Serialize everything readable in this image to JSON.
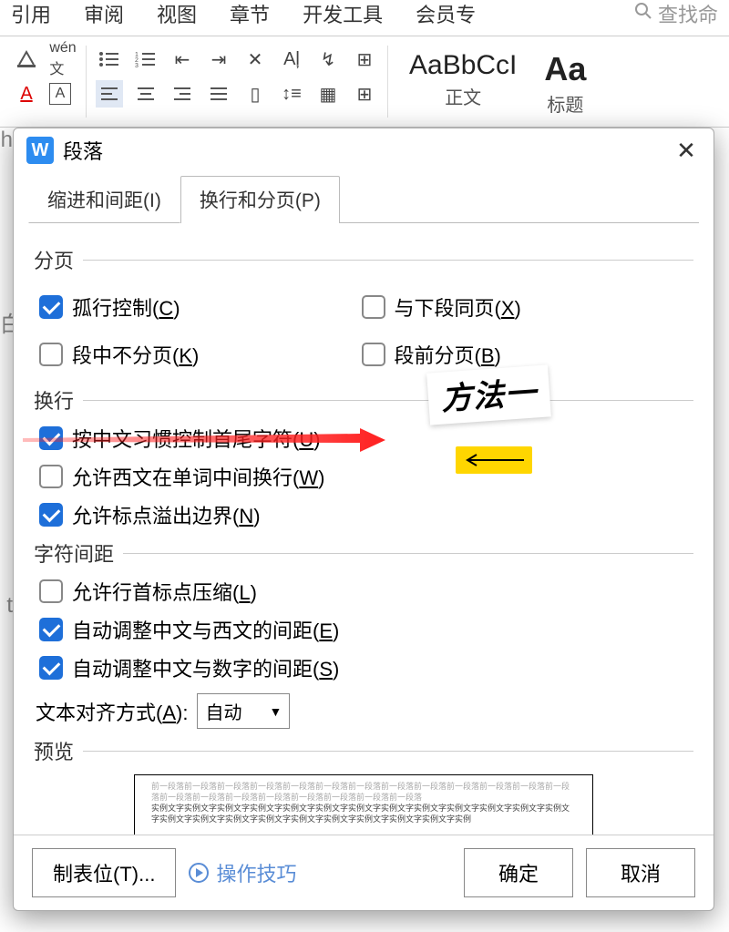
{
  "ribbon": {
    "menus": [
      "引用",
      "审阅",
      "视图",
      "章节",
      "开发工具",
      "会员专"
    ],
    "search_placeholder": "查找命"
  },
  "styles": {
    "s1_preview": "AaBbCcI",
    "s1_label": "正文",
    "s2_preview": "Aa",
    "s2_label": "标题"
  },
  "dialog": {
    "title": "段落",
    "tabs": {
      "indent": "缩进和间距(I)",
      "line": "换行和分页(P)"
    },
    "section_page": "分页",
    "section_wrap": "换行",
    "section_spacing": "字符间距",
    "section_preview": "预览",
    "options": {
      "widow": {
        "label_pre": "孤行控制(",
        "key": "C",
        "label_post": ")",
        "checked": true
      },
      "keep_next": {
        "label_pre": "与下段同页(",
        "key": "X",
        "label_post": ")",
        "checked": false
      },
      "keep_together": {
        "label_pre": "段中不分页(",
        "key": "K",
        "label_post": ")",
        "checked": false
      },
      "page_break": {
        "label_pre": "段前分页(",
        "key": "B",
        "label_post": ")",
        "checked": false
      },
      "cjk_first": {
        "label_pre": "按中文习惯控制首尾字符(",
        "key": "U",
        "label_post": ")",
        "checked": true
      },
      "latin_wrap": {
        "label_pre": "允许西文在单词中间换行(",
        "key": "W",
        "label_post": ")",
        "checked": false
      },
      "punct_overflow": {
        "label_pre": "允许标点溢出边界(",
        "key": "N",
        "label_post": ")",
        "checked": true
      },
      "punct_compress": {
        "label_pre": "允许行首标点压缩(",
        "key": "L",
        "label_post": ")",
        "checked": false
      },
      "cjk_latin_space": {
        "label_pre": "自动调整中文与西文的间距(",
        "key": "E",
        "label_post": ")",
        "checked": true
      },
      "cjk_digit_space": {
        "label_pre": "自动调整中文与数字的间距(",
        "key": "S",
        "label_post": ")",
        "checked": true
      }
    },
    "align_label_pre": "文本对齐方式(",
    "align_key": "A",
    "align_label_post": "):",
    "align_value": "自动",
    "preview_light": "前一段落前一段落前一段落前一段落前一段落前一段落前一段落前一段落前一段落前一段落前一段落前一段落前一段落前一段落前一段落前一段落前一段落前一段落前一段落前一段落前一段落",
    "preview_dark": "实例文字实例文字实例文字实例文字实例文字实例文字实例文字实例文字实例文字实例文字实例文字实例文字实例文字实例文字实例文字实例文字实例文字实例文字实例文字实例文字实例文字实例文字实例",
    "footer": {
      "tabs_btn": "制表位(T)...",
      "tips": "操作技巧",
      "ok": "确定",
      "cancel": "取消"
    }
  },
  "annotation": "方法一"
}
